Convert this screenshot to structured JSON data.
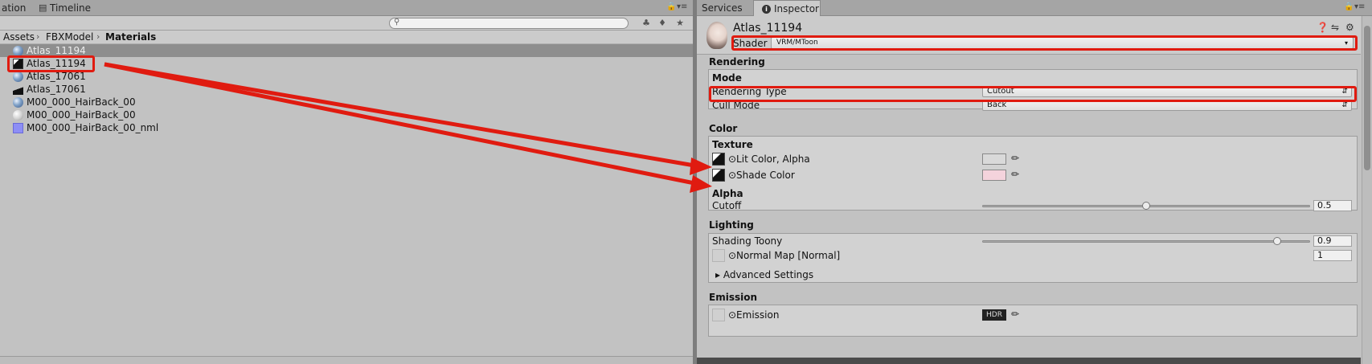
{
  "project": {
    "tabs": {
      "animation_partial": "ation",
      "timeline": "Timeline"
    },
    "search": {
      "placeholder": ""
    },
    "breadcrumb": [
      "Assets",
      "FBXModel",
      "Materials"
    ],
    "items": [
      {
        "label": "Atlas_11194",
        "icon": "material-sphere-icon",
        "selected": true
      },
      {
        "label": "Atlas_11194",
        "icon": "texture-icon",
        "selected": false
      },
      {
        "label": "Atlas_17061",
        "icon": "material-sphere-icon",
        "selected": false
      },
      {
        "label": "Atlas_17061",
        "icon": "texture-icon",
        "selected": false
      },
      {
        "label": "M00_000_HairBack_00",
        "icon": "material-sphere-icon",
        "selected": false
      },
      {
        "label": "M00_000_HairBack_00",
        "icon": "white-material-icon",
        "selected": false
      },
      {
        "label": "M00_000_HairBack_00_nml",
        "icon": "normal-map-icon",
        "selected": false
      }
    ]
  },
  "inspector": {
    "tabs": {
      "services": "Services",
      "inspector": "Inspector"
    },
    "material_name": "Atlas_11194",
    "shader_label": "Shader",
    "shader_value": "VRM/MToon",
    "sections": {
      "rendering": {
        "title": "Rendering",
        "mode_title": "Mode",
        "rendering_type_label": "Rendering Type",
        "rendering_type_value": "Cutout",
        "cull_mode_label": "Cull Mode",
        "cull_mode_value": "Back"
      },
      "color": {
        "title": "Color",
        "texture_title": "Texture",
        "lit_color_label": "⊙Lit Color, Alpha",
        "shade_color_label": "⊙Shade Color",
        "lit_swatch": "#d9d9d9",
        "shade_swatch": "#f4d3dc",
        "alpha_title": "Alpha",
        "cutoff_label": "Cutoff",
        "cutoff_value": "0.5",
        "cutoff_fraction": 0.5
      },
      "lighting": {
        "title": "Lighting",
        "shading_toony_label": "Shading Toony",
        "shading_toony_value": "0.9",
        "shading_toony_fraction": 0.9,
        "normal_map_label": "⊙Normal Map [Normal]",
        "normal_map_value": "1",
        "advanced_label": "Advanced Settings"
      },
      "emission": {
        "title": "Emission",
        "emission_label": "⊙Emission",
        "hdr_label": "HDR"
      }
    },
    "preview_label": "Atlas_11194"
  },
  "colors": {
    "highlight": "#e01b10",
    "selection": "#8e8e8e"
  }
}
